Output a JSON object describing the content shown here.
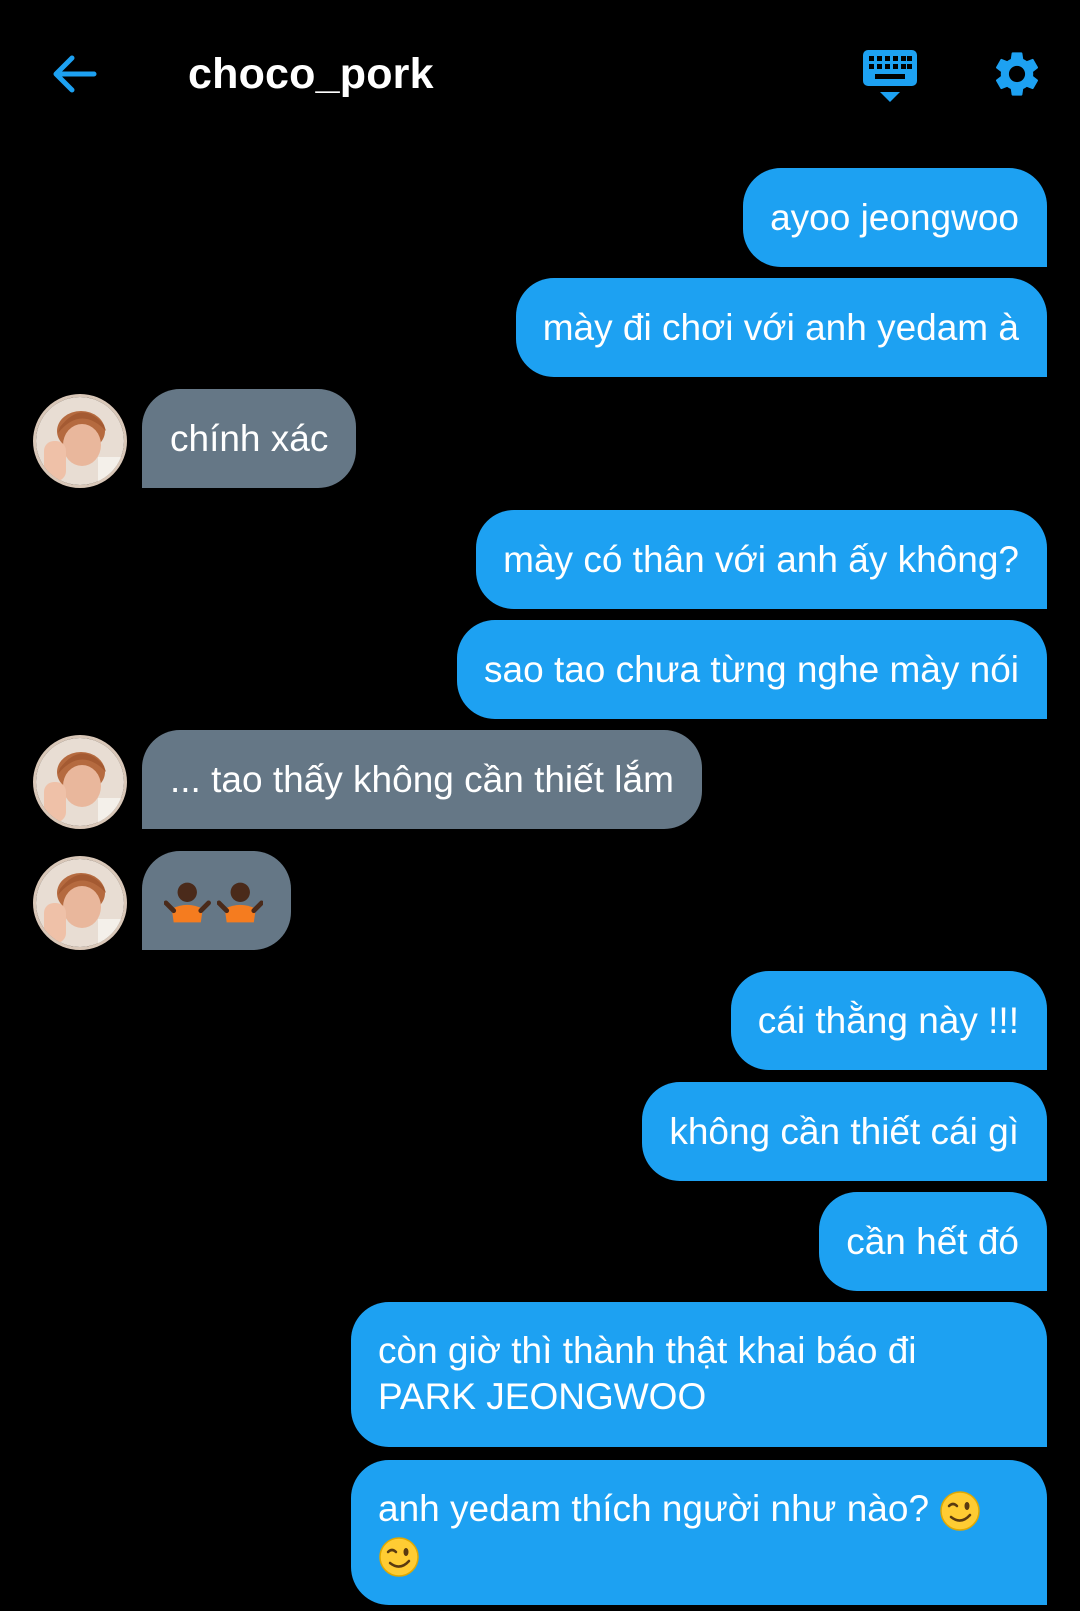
{
  "header": {
    "title": "choco_pork",
    "back_icon": "arrow-left-icon",
    "keyboard_icon": "keyboard-icon",
    "settings_icon": "gear-icon",
    "accent_color": "#1da1f2"
  },
  "colors": {
    "outgoing_bubble": "#1da1f2",
    "incoming_bubble": "#657786",
    "background": "#000000"
  },
  "messages": [
    {
      "sender": "me",
      "text": "ayoo jeongwoo"
    },
    {
      "sender": "me",
      "text": "mày đi chơi với anh yedam à"
    },
    {
      "sender": "choco_pork",
      "text": "chính xác"
    },
    {
      "sender": "me",
      "text": "mày có thân với anh ấy không?"
    },
    {
      "sender": "me",
      "text": "sao tao chưa từng nghe mày nói"
    },
    {
      "sender": "choco_pork",
      "text": "... tao thấy không cần thiết lắm"
    },
    {
      "sender": "choco_pork",
      "text": "",
      "emoji": [
        "person-shrugging-emoji",
        "person-shrugging-emoji"
      ]
    },
    {
      "sender": "me",
      "text": "cái thằng này !!!"
    },
    {
      "sender": "me",
      "text": "không cần thiết cái gì"
    },
    {
      "sender": "me",
      "text": "cần hết đó"
    },
    {
      "sender": "me",
      "text_line1": "còn giờ thì thành thật khai báo đi",
      "text_line2": "PARK JEONGWOO"
    },
    {
      "sender": "me",
      "text": "anh yedam thích người như nào?",
      "emoji": [
        "winking-face-emoji",
        "winking-face-emoji"
      ]
    }
  ]
}
